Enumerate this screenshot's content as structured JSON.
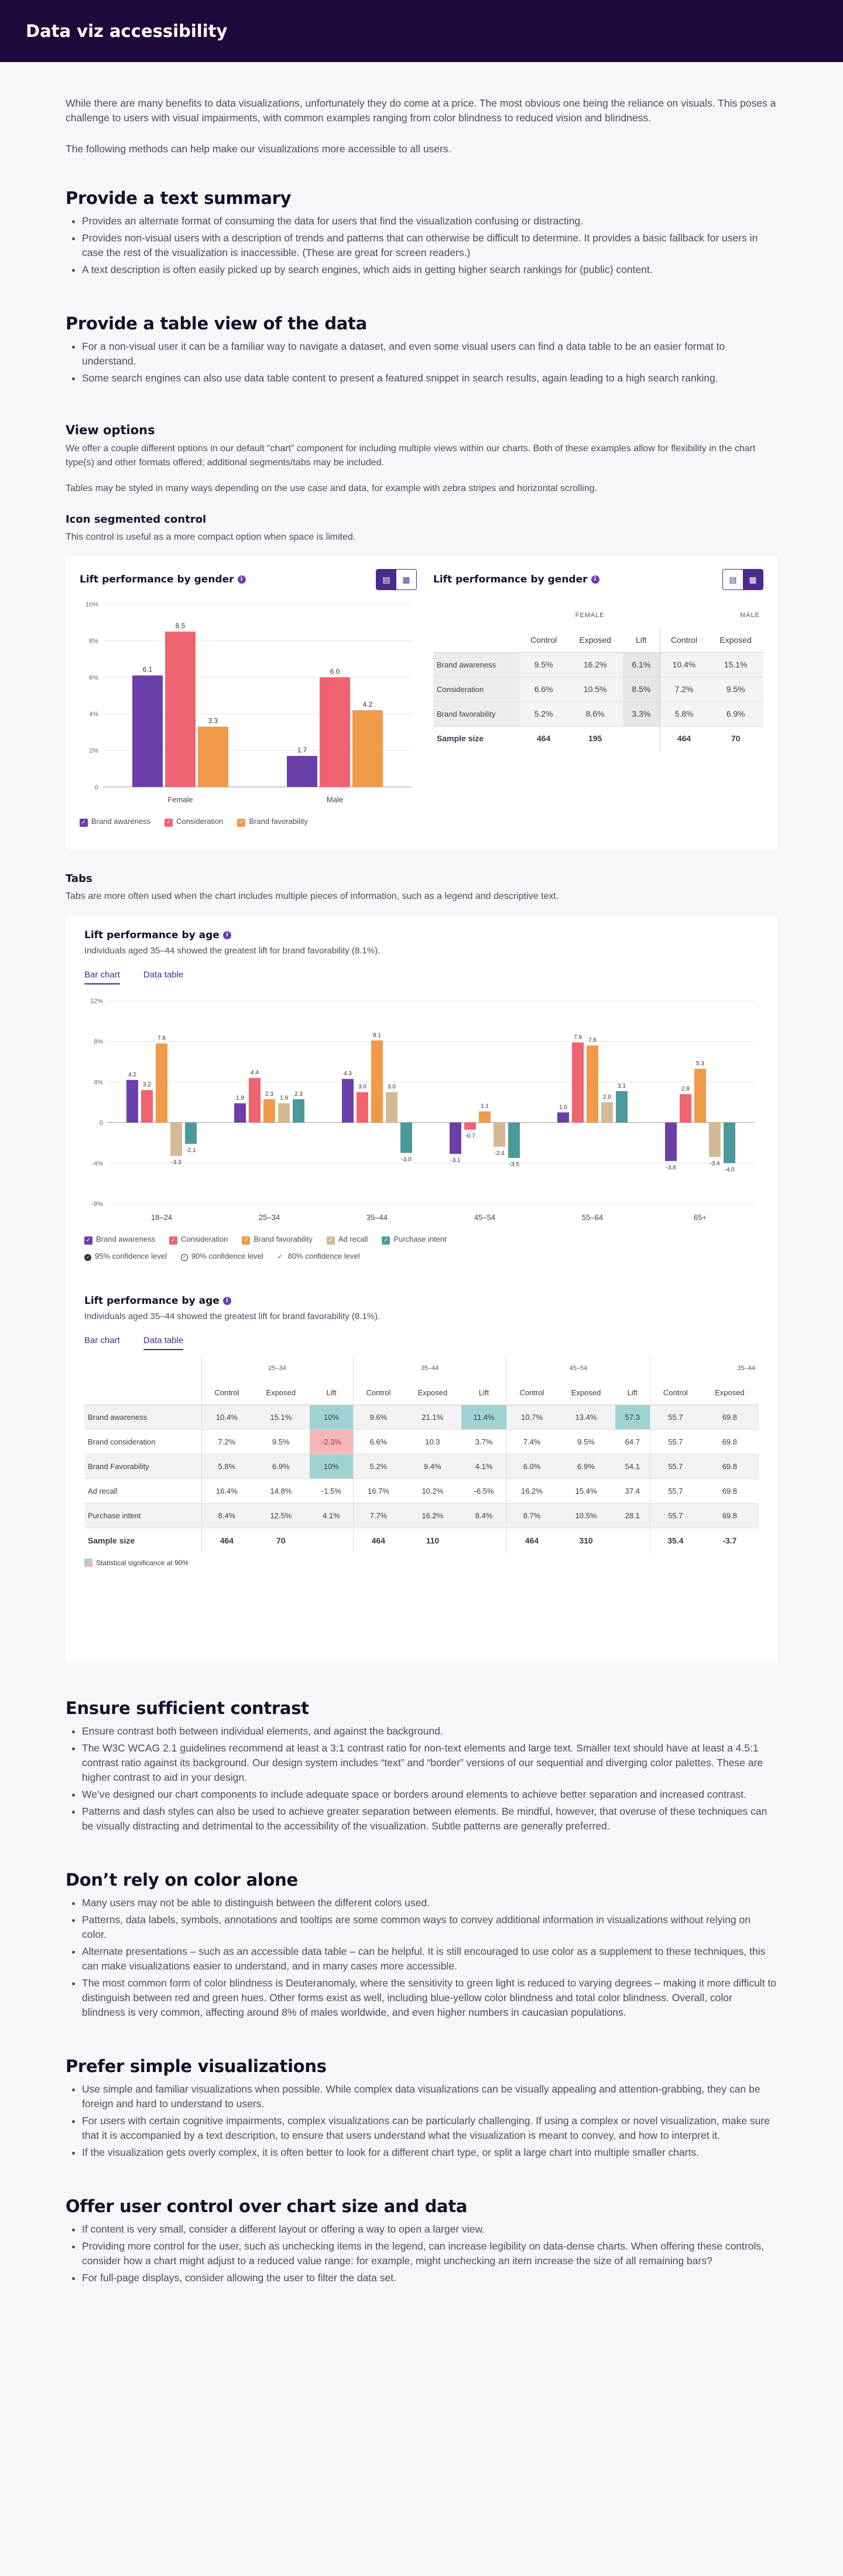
{
  "header": {
    "title": "Data viz accessibility"
  },
  "intro": [
    "While there are many benefits to data visualizations, unfortunately they do come at a price. The most obvious one being the reliance on visuals. This poses a challenge to users with visual impairments, with common examples ranging from color blindness to reduced vision and blindness.",
    "The following methods can help make our visualizations more accessible to all users."
  ],
  "text_summary": {
    "title": "Provide a text summary",
    "items": [
      "Provides an alternate format of consuming the data for users that find the visualization confusing or distracting.",
      "Provides non-visual users with a description of trends and patterns that can otherwise be difficult to determine. It provides a basic fallback for users in case the rest of the visualization is inaccessible. (These are great for screen readers.)",
      "A text description is often easily picked up by search engines, which aids in getting higher search rankings for (public) content."
    ]
  },
  "table_view": {
    "title": "Provide a table view of the data",
    "items": [
      "For a non-visual user it can be a familiar way to navigate a dataset, and even some visual users can find a data table to be an easier format to understand.",
      "Some search engines can also use data table content to present a featured snippet in search results, again leading to a high search ranking."
    ]
  },
  "view_options": {
    "title": "View options",
    "p1": "We offer a couple different options in our default “chart” component for including multiple views within our charts. Both of these examples allow for flexibility in the chart type(s) and other formats offered; additional segments/tabs may be included.",
    "p2": "Tables may be styled in many ways depending on the use case and data, for example with zebra stripes and horizontal scrolling."
  },
  "segmented": {
    "title": "Icon segmented control",
    "desc": "This control is useful as a more compact option when space is limited.",
    "chart_title": "Lift performance by gender",
    "table_title": "Lift performance by gender"
  },
  "chart_data": [
    {
      "type": "bar",
      "title": "Lift performance by gender",
      "categories": [
        "Female",
        "Male"
      ],
      "ylim": [
        0,
        10
      ],
      "yticks": [
        "0",
        "2%",
        "4%",
        "6%",
        "8%",
        "10%"
      ],
      "series": [
        {
          "name": "Brand awareness",
          "values": [
            6.1,
            1.7
          ],
          "color": "#6b3fa8"
        },
        {
          "name": "Consideration",
          "values": [
            8.5,
            6.0
          ],
          "color": "#f06370"
        },
        {
          "name": "Brand favorability",
          "values": [
            3.3,
            4.2
          ],
          "color": "#f09a4a"
        }
      ]
    },
    {
      "type": "bar",
      "title": "Lift performance by age",
      "categories": [
        "18–24",
        "25–34",
        "35–44",
        "45–54",
        "55–64",
        "65+"
      ],
      "ylim": [
        -8,
        12
      ],
      "yticks": [
        "-8%",
        "-4%",
        "0",
        "4%",
        "8%",
        "12%"
      ],
      "series": [
        {
          "name": "Brand awareness",
          "values": [
            4.2,
            1.9,
            4.3,
            -3.1,
            1.0,
            -3.8
          ],
          "color": "#6b3fa8"
        },
        {
          "name": "Consideration",
          "values": [
            3.2,
            4.4,
            3.0,
            -0.7,
            7.9,
            2.8
          ],
          "color": "#f06370"
        },
        {
          "name": "Brand favorability",
          "values": [
            7.8,
            2.3,
            8.1,
            1.1,
            7.6,
            5.3
          ],
          "color": "#f09a4a"
        },
        {
          "name": "Ad recall",
          "values": [
            -3.3,
            1.9,
            3.0,
            -2.4,
            2.0,
            -3.4
          ],
          "color": "#d4b996"
        },
        {
          "name": "Purchase intent",
          "values": [
            -2.1,
            2.3,
            -3.0,
            -3.5,
            3.1,
            -4.0
          ],
          "color": "#4a9a9a"
        }
      ]
    }
  ],
  "gender_table": {
    "group_female": "FEMALE",
    "group_male": "MALE",
    "headers": [
      "Control",
      "Exposed",
      "Lift",
      "Control",
      "Exposed"
    ],
    "rows": [
      {
        "label": "Brand awareness",
        "cells": [
          "9.5%",
          "16.2%",
          "6.1%",
          "10.4%",
          "15.1%"
        ]
      },
      {
        "label": "Consideration",
        "cells": [
          "6.6%",
          "10.5%",
          "8.5%",
          "7.2%",
          "9.5%"
        ]
      },
      {
        "label": "Brand favorability",
        "cells": [
          "5.2%",
          "8.6%",
          "3.3%",
          "5.8%",
          "6.9%"
        ]
      }
    ],
    "sample": {
      "label": "Sample size",
      "cells": [
        "464",
        "195",
        "",
        "464",
        "70"
      ]
    }
  },
  "tabs_section": {
    "title": "Tabs",
    "desc": "Tabs are more often used when the chart includes multiple pieces of information, such as a legend and descriptive text.",
    "card_title": "Lift performance by age",
    "card_sub": "Individuals aged 35–44 showed the greatest lift for brand favorability (8.1%).",
    "tab_bar": "Bar chart",
    "tab_table": "Data table",
    "conf": [
      "95% confidence level",
      "90% confidence level",
      "80% confidence level"
    ]
  },
  "age_table": {
    "groups": [
      "25–34",
      "35–44",
      "45–54",
      "35–44"
    ],
    "headers": [
      "Control",
      "Exposed",
      "Lift",
      "Control",
      "Exposed",
      "Lift",
      "Control",
      "Exposed",
      "Lift",
      "Control",
      "Exposed"
    ],
    "rows": [
      {
        "label": "Brand awareness",
        "cells": [
          "10.4%",
          "15.1%",
          "10%",
          "9.6%",
          "21.1%",
          "11.4%",
          "10.7%",
          "13.4%",
          "57.3",
          "55.7",
          "69.8"
        ]
      },
      {
        "label": "Brand consideration",
        "cells": [
          "7.2%",
          "9.5%",
          "-2.3%",
          "6.6%",
          "10.3",
          "3.7%",
          "7.4%",
          "9.5%",
          "64.7",
          "55.7",
          "69.8"
        ]
      },
      {
        "label": "Brand Favorability",
        "cells": [
          "5.8%",
          "6.9%",
          "10%",
          "5.2%",
          "9.4%",
          "4.1%",
          "6.0%",
          "6.9%",
          "54.1",
          "55.7",
          "69.8"
        ]
      },
      {
        "label": "Ad recall",
        "cells": [
          "16.4%",
          "14.8%",
          "-1.5%",
          "16.7%",
          "10.2%",
          "-6.5%",
          "16.2%",
          "15.4%",
          "37.4",
          "55.7",
          "69.8"
        ]
      },
      {
        "label": "Purchase intent",
        "cells": [
          "8.4%",
          "12.5%",
          "4.1%",
          "7.7%",
          "16.2%",
          "8.4%",
          "8.7%",
          "10.5%",
          "28.1",
          "55.7",
          "69.8"
        ]
      }
    ],
    "sample": {
      "label": "Sample size",
      "cells": [
        "464",
        "70",
        "",
        "464",
        "110",
        "",
        "464",
        "310",
        "",
        "35.4",
        "-3.7"
      ]
    },
    "note": "Statistical significance at 90%"
  },
  "contrast": {
    "title": "Ensure sufficient contrast",
    "items": [
      "Ensure contrast both between individual elements, and against the background.",
      "The W3C WCAG 2.1 guidelines recommend at least a 3:1 contrast ratio for non-text elements and large text. Smaller text should have at least a 4.5:1 contrast ratio against its background. Our design system includes “text” and “border” versions of our sequential and diverging color palettes. These are higher contrast to aid in your design.",
      "We’ve designed our chart components to include adequate space or borders around elements to achieve better separation and increased contrast.",
      "Patterns and dash styles can also be used to achieve greater separation between elements. Be mindful, however, that overuse of these techniques can be visually distracting and detrimental to the accessibility of the visualization. Subtle patterns are generally preferred."
    ]
  },
  "color_alone": {
    "title": "Don’t rely on color alone",
    "items": [
      "Many users may not be able to distinguish between the different colors used.",
      "Patterns, data labels, symbols, annotations and tooltips are some common ways to convey additional information in visualizations without relying on color.",
      "Alternate presentations – such as an accessible data table – can be helpful. It is still encouraged to use color as a supplement to these techniques, this can make visualizations easier to understand, and in many cases more accessible.",
      "The most common form of color blindness is Deuteranomaly, where the sensitivity to green light is reduced to varying degrees – making it more difficult to distinguish between red and green hues. Other forms exist as well, including blue-yellow color blindness and total color blindness. Overall, color blindness is very common, affecting around 8% of males worldwide, and even higher numbers in caucasian populations."
    ]
  },
  "simple": {
    "title": "Prefer simple visualizations",
    "items": [
      "Use simple and familiar visualizations when possible. While complex data visualizations can be visually appealing and attention-grabbing, they can be foreign and hard to understand to users.",
      "For users with certain cognitive impairments, complex visualizations can be particularly challenging. If using a complex or novel visualization, make sure that it is accompanied by a text description, to ensure that users understand what the visualization is meant to convey, and how to interpret it.",
      "If the visualization gets overly complex, it is often better to look for a different chart type, or split a large chart into multiple smaller charts."
    ]
  },
  "control": {
    "title": "Offer user control over chart size and data",
    "items": [
      "If content is very small, consider a different layout or offering a way to open a larger view.",
      "Providing more control for the user, such as unchecking items in the legend, can increase legibility on data-dense charts. When offering these controls, consider how a chart might adjust to a reduced value range: for example, might unchecking an item increase the size of all remaining bars?",
      "For full-page displays, consider allowing the user to filter the data set."
    ]
  }
}
